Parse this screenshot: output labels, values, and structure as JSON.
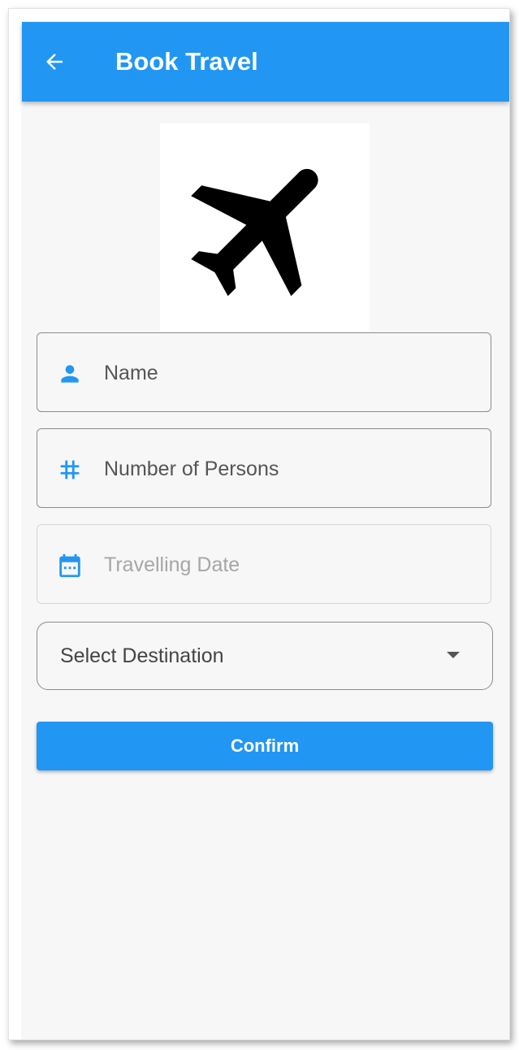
{
  "app_bar": {
    "title": "Book Travel",
    "back_icon": "arrow-back-icon",
    "background_color": "#2196f3"
  },
  "logo": {
    "icon": "airplane-icon"
  },
  "form": {
    "name": {
      "placeholder": "Name",
      "value": "",
      "icon": "person-icon"
    },
    "persons": {
      "placeholder": "Number of Persons",
      "value": "",
      "icon": "hash-icon"
    },
    "date": {
      "placeholder": "Travelling Date",
      "value": "",
      "icon": "calendar-icon",
      "enabled": false
    },
    "destination": {
      "label": "Select Destination",
      "icon": "dropdown-arrow-icon"
    }
  },
  "actions": {
    "confirm_label": "Confirm"
  },
  "colors": {
    "accent": "#2196f3",
    "background": "#f7f7f7",
    "icon": "#2196f3"
  }
}
